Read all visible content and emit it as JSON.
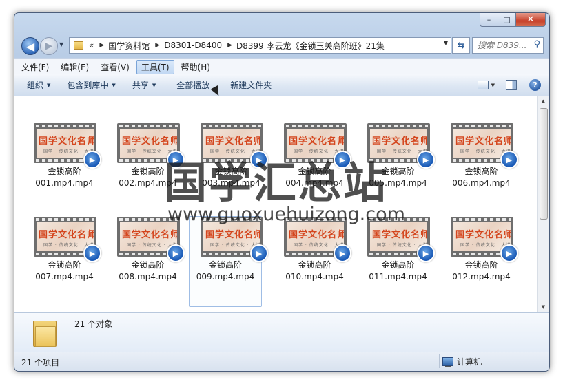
{
  "window": {
    "caption_buttons": {
      "minimize": "–",
      "maximize": "□",
      "close": "✕"
    }
  },
  "nav": {
    "back_glyph": "◀",
    "forward_glyph": "▶",
    "overflow": "«",
    "breadcrumb": [
      "国学资料馆",
      "D8301-D8400",
      "D8399 李云龙《金锁玉关高阶班》21集"
    ],
    "search_placeholder": "搜索 D839...",
    "icons": [
      "back-arrow-icon",
      "forward-arrow-icon",
      "folder-icon",
      "refresh-icon",
      "search-icon"
    ]
  },
  "menu": {
    "items": [
      "文件(F)",
      "编辑(E)",
      "查看(V)",
      "工具(T)",
      "帮助(H)"
    ],
    "active": "工具(T)"
  },
  "toolbar": {
    "organize": "组织",
    "include_library": "包含到库中",
    "share": "共享",
    "play_all": "全部播放",
    "new_folder": "新建文件夹"
  },
  "files": [
    {
      "name_line1": "金锁高阶",
      "name_line2": "001.mp4.mp4"
    },
    {
      "name_line1": "金锁高阶",
      "name_line2": "002.mp4.mp4"
    },
    {
      "name_line1": "金锁高阶",
      "name_line2": "003.mp4.mp4"
    },
    {
      "name_line1": "金锁高阶",
      "name_line2": "004.mp4.mp4"
    },
    {
      "name_line1": "金锁高阶",
      "name_line2": "005.mp4.mp4"
    },
    {
      "name_line1": "金锁高阶",
      "name_line2": "006.mp4.mp4"
    },
    {
      "name_line1": "金锁高阶",
      "name_line2": "007.mp4.mp4"
    },
    {
      "name_line1": "金锁高阶",
      "name_line2": "008.mp4.mp4"
    },
    {
      "name_line1": "金锁高阶",
      "name_line2": "009.mp4.mp4"
    },
    {
      "name_line1": "金锁高阶",
      "name_line2": "010.mp4.mp4"
    },
    {
      "name_line1": "金锁高阶",
      "name_line2": "011.mp4.mp4"
    },
    {
      "name_line1": "金锁高阶",
      "name_line2": "012.mp4.mp4"
    }
  ],
  "selected_file_index": 8,
  "thumbnail": {
    "title": "国学文化名师",
    "subtitle": "国学 · 传统文化 · 大讲堂"
  },
  "watermark": {
    "text": "国学汇总站",
    "url": "www.guoxuehuizong.com"
  },
  "details": {
    "object_count": "21 个对象"
  },
  "status": {
    "items": "21 个项目",
    "location": "计算机"
  },
  "colors": {
    "accent": "#2b5ea8",
    "play_badge": "#1858b5",
    "thumb_title": "#d4461e"
  }
}
